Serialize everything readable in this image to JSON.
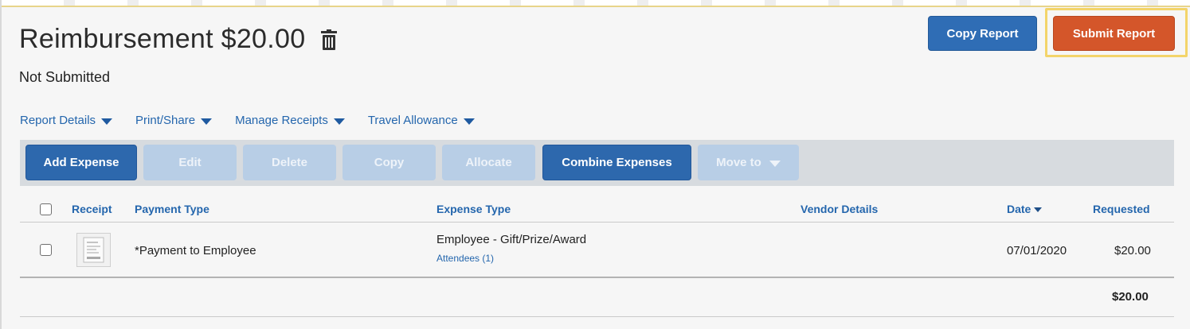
{
  "report": {
    "title": "Reimbursement $20.00",
    "status": "Not Submitted"
  },
  "actions": {
    "copy_report": "Copy Report",
    "submit_report": "Submit Report"
  },
  "menu": [
    {
      "label": "Report Details"
    },
    {
      "label": "Print/Share"
    },
    {
      "label": "Manage Receipts"
    },
    {
      "label": "Travel Allowance"
    }
  ],
  "toolbar": {
    "add_expense": "Add Expense",
    "edit": "Edit",
    "delete": "Delete",
    "copy": "Copy",
    "allocate": "Allocate",
    "combine_expenses": "Combine Expenses",
    "move_to": "Move to"
  },
  "table": {
    "columns": {
      "receipt": "Receipt",
      "payment_type": "Payment Type",
      "expense_type": "Expense Type",
      "vendor_details": "Vendor Details",
      "date": "Date",
      "requested": "Requested"
    },
    "rows": [
      {
        "payment_type": "*Payment to Employee",
        "expense_type": "Employee - Gift/Prize/Award",
        "attendees": "Attendees (1)",
        "vendor_details": "",
        "date": "07/01/2020",
        "requested": "$20.00"
      }
    ],
    "total": "$20.00"
  },
  "colors": {
    "primary_blue": "#2f6db5",
    "submit_orange": "#d4562a",
    "highlight_yellow": "#f3d46a",
    "link_blue": "#2466ad",
    "disabled_blue": "#b8cee6"
  },
  "icons": {
    "trash": "trash-icon",
    "caret": "caret-down-icon",
    "receipt": "receipt-thumbnail"
  }
}
